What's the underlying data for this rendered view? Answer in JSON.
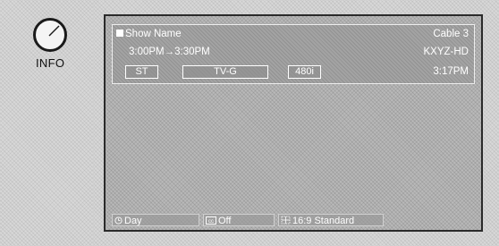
{
  "side_panel": {
    "info_label": "INFO"
  },
  "banner": {
    "show_name": "Show Name",
    "channel": "Cable 3",
    "time_range": "3:00PM→3:30PM",
    "station": "KXYZ-HD",
    "badges": [
      "ST",
      "TV-G",
      "480i"
    ],
    "current_time": "3:17PM"
  },
  "bottom_bar": {
    "day_label": "Day",
    "cc_label": "Off",
    "aspect_label": "16:9 Standard"
  },
  "icons": {
    "info_button": "info-dial-icon",
    "day": "clock-icon",
    "cc": "closed-caption-icon",
    "aspect": "aspect-ratio-icon"
  }
}
